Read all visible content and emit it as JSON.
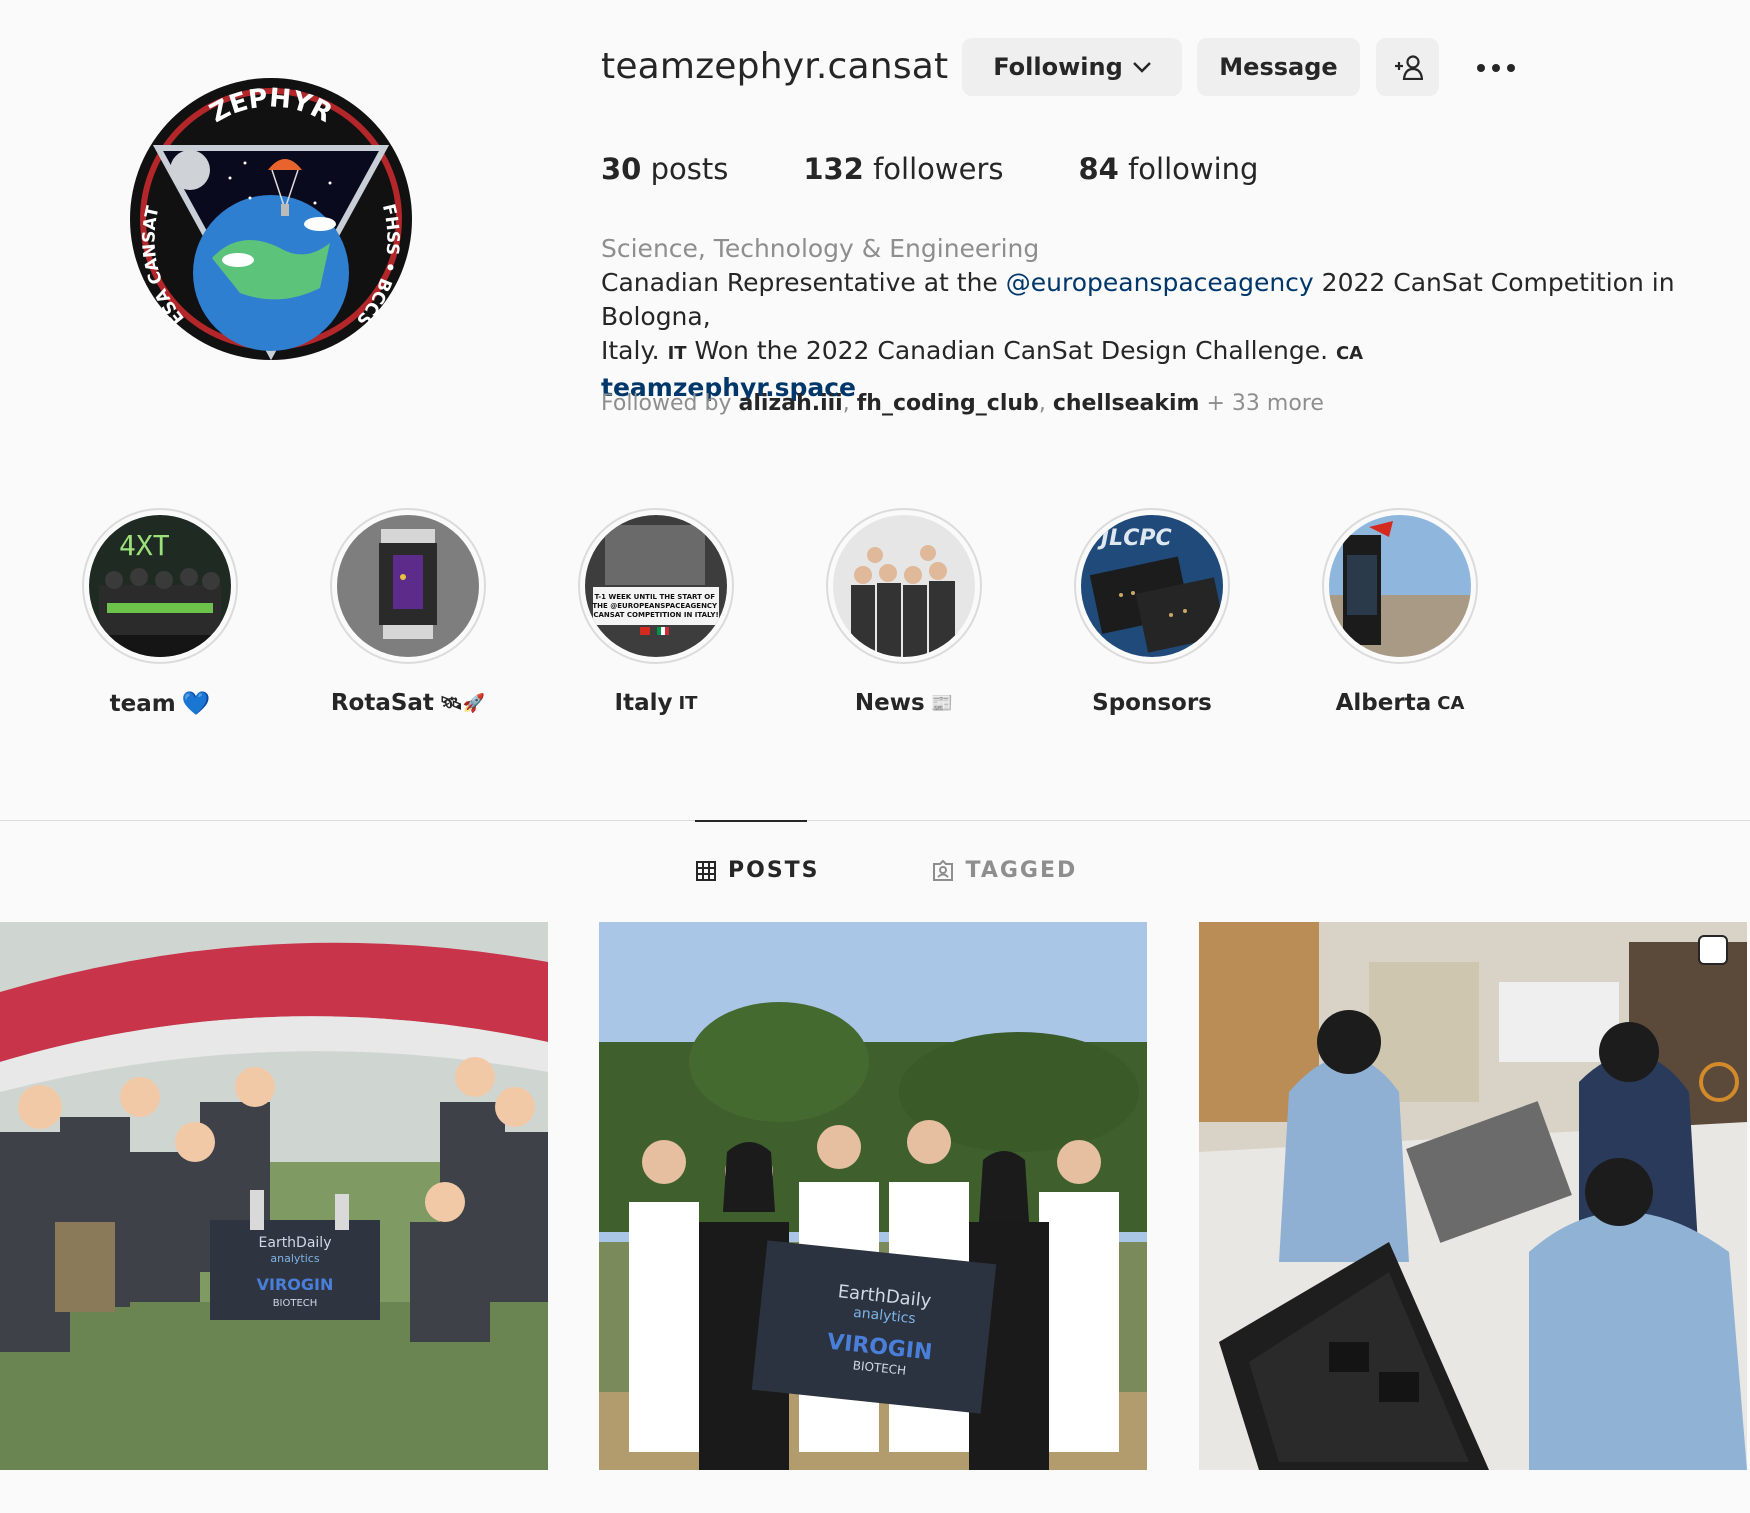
{
  "profile": {
    "username": "teamzephyr.cansat",
    "following_label": "Following",
    "message_label": "Message",
    "avatar": {
      "top_text": "ZEPHYR",
      "left_text": "ESA CANSAT",
      "right_text": "FHSS • BCCS"
    }
  },
  "stats": {
    "posts_count": "30",
    "posts_label": "posts",
    "followers_count": "132",
    "followers_label": "followers",
    "following_count": "84",
    "following_label": "following"
  },
  "bio": {
    "category": "Science, Technology & Engineering",
    "line1_prefix": "Canadian Representative at the ",
    "mention": "@europeanspaceagency",
    "line1_suffix": " 2022 CanSat Competition in Bologna,",
    "line2_prefix": "Italy. ",
    "flag_it": "IT",
    "line2_middle": " Won the 2022 Canadian CanSat Design Challenge. ",
    "flag_ca": "CA",
    "link": "teamzephyr.space"
  },
  "followed_by": {
    "prefix": "Followed by ",
    "user1": "alizah.iii",
    "sep1": ", ",
    "user2": "fh_coding_club",
    "sep2": ", ",
    "user3": "chellseakim",
    "suffix": " + 33 more"
  },
  "highlights": [
    {
      "label": "team",
      "emoji": "💙"
    },
    {
      "label": "RotaSat",
      "emoji": "🛰🚀"
    },
    {
      "label": "Italy",
      "emoji": "IT"
    },
    {
      "label": "News",
      "emoji": "📰"
    },
    {
      "label": "Sponsors",
      "emoji": ""
    },
    {
      "label": "Alberta",
      "emoji": "CA"
    }
  ],
  "highlight_texts": {
    "italy_banner": "T-1 WEEK UNTIL THE START OF THE @EUROPEANSPACEAGENCY CANSAT COMPETITION IN ITALY!",
    "sponsors_text": "JLCPC"
  },
  "tabs": {
    "posts": "POSTS",
    "tagged": "TAGGED"
  },
  "posts": {
    "banner_line1": "EarthDaily",
    "banner_line2": "analytics",
    "banner_line3": "VIROGIN",
    "banner_line4": "BIOTECH"
  },
  "colors": {
    "accent_link": "#00376b",
    "muted": "#8e8e8e",
    "button_bg": "#efefef",
    "heart": "#1877f2"
  }
}
